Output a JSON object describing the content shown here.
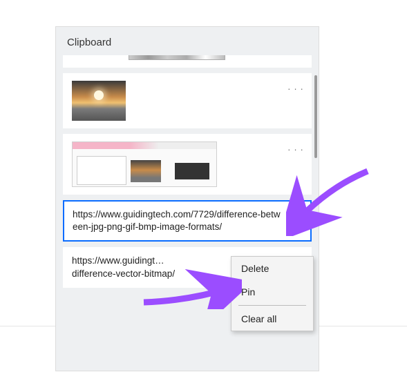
{
  "panel": {
    "title": "Clipboard"
  },
  "items": {
    "text1": "https://www.guidingtech.com/7729/difference-between-jpg-png-gif-bmp-image-formats/",
    "text2_visible": "https://www.guidingt…\ndifference-vector-bitmap/"
  },
  "menu": {
    "delete": "Delete",
    "pin": "Pin",
    "clear": "Clear all"
  },
  "glyphs": {
    "ellipsis": ". . ."
  }
}
